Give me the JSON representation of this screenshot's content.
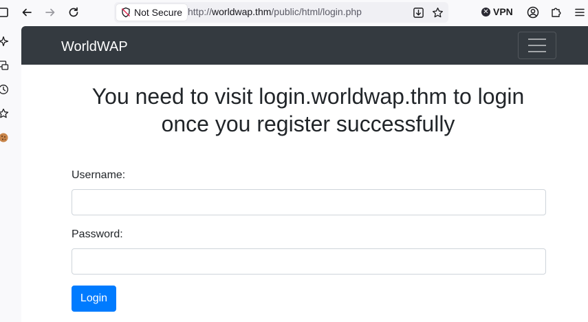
{
  "browser": {
    "security_label": "Not Secure",
    "url_prefix": "http://",
    "url_host": "worldwap.thm",
    "url_path": "/public/html/login.php",
    "vpn_label": "VPN",
    "icons": {
      "back": "arrow-left-icon",
      "forward": "arrow-right-icon",
      "reload": "reload-icon",
      "security": "shield-slash-icon",
      "download": "download-icon",
      "bookmark": "star-icon",
      "vpn": "vpn-status-icon",
      "account": "account-icon",
      "extensions": "puzzle-icon",
      "menu": "hamburger-menu-icon"
    }
  },
  "sidebar": {
    "icons": [
      "sparkle-icon",
      "synced-tabs-icon",
      "history-icon",
      "bookmarks-icon",
      "cookie-icon"
    ]
  },
  "navbar": {
    "brand": "WorldWAP",
    "background": "#343a40"
  },
  "main": {
    "heading_line1": "You need to visit login.worldwap.thm to login",
    "heading_line2": "once you register successfully",
    "username_label": "Username:",
    "username_value": "",
    "password_label": "Password:",
    "password_value": "",
    "login_button": "Login",
    "accent": "#007bff"
  }
}
